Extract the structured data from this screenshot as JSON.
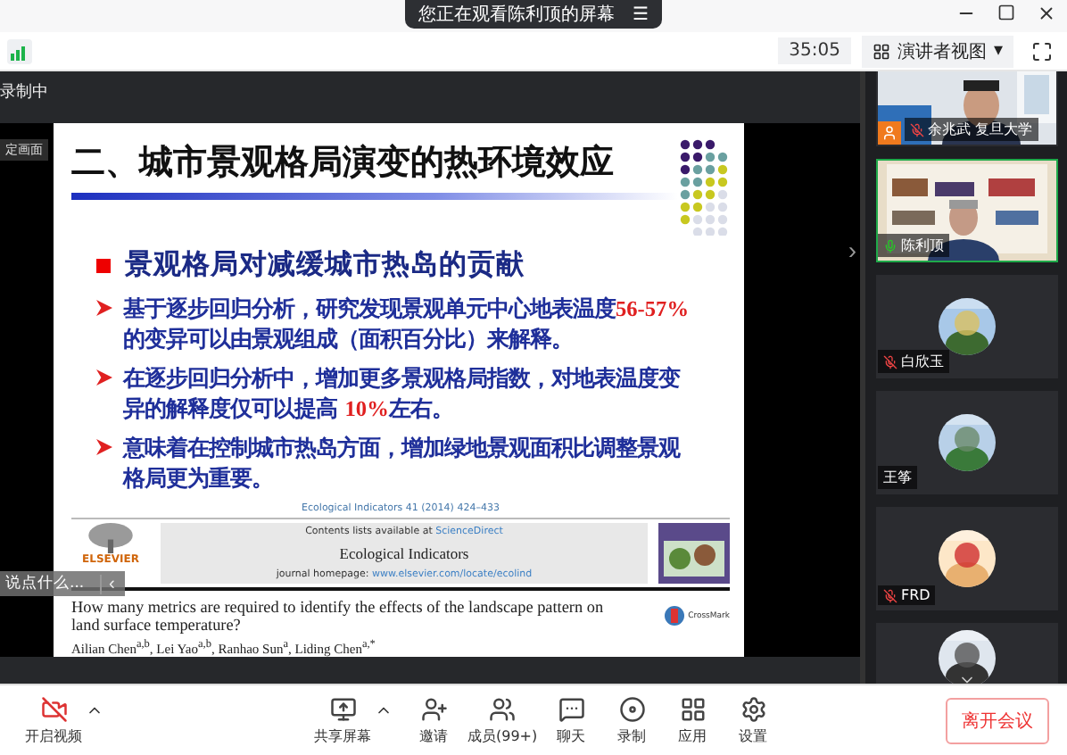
{
  "banner": {
    "text": "您正在观看陈利顶的屏幕",
    "menu_icon": "☰"
  },
  "timer": "35:05",
  "view_menu": {
    "label": "演讲者视图",
    "caret": "▾"
  },
  "recording": "录制中",
  "stage_label": "定画面",
  "slide": {
    "title": "二、城市景观格局演变的热环境效应",
    "heading": "景观格局对减缓城市热岛的贡献",
    "bullets": [
      [
        {
          "text": "基于逐步回归分析，研究发现景观单元中心地表温度",
          "highlight": false
        },
        {
          "text": "56-57%",
          "highlight": true
        },
        {
          "text": "的变异可以由景观组成（面积百分比）来解释。",
          "highlight": false
        }
      ],
      [
        {
          "text": "在逐步回归分析中，增加更多景观格局指数，对地表温度变异的解释度仅可以提高 ",
          "highlight": false
        },
        {
          "text": "10%",
          "highlight": true
        },
        {
          "text": "左右。",
          "highlight": false
        }
      ],
      [
        {
          "text": "意味着在控制城市热岛方面，增加绿地景观面积比调整景观格局更为重要。",
          "highlight": false
        }
      ]
    ],
    "paper": {
      "citation": "Ecological Indicators 41 (2014) 424–433",
      "publisher": "ELSEVIER",
      "contents": "Contents lists available at",
      "contents_link": "ScienceDirect",
      "journal": "Ecological Indicators",
      "homepage": "journal homepage:",
      "homepage_link": "www.elsevier.com/locate/ecolind",
      "title": "How many metrics are required to identify the effects of the landscape pattern on land surface temperature?",
      "crossmark": "CrossMark",
      "authors": "Ailian Chen$^{a,b}$, Lei Yao$^{a,b}$, Ranhao Sun$^{a}$, Liding Chen$^{a,*}$"
    }
  },
  "comment": {
    "placeholder": "说点什么...",
    "arrow": "‹"
  },
  "next_arrow": "›",
  "participants": [
    {
      "name": "余兆武 复旦大学",
      "kind": "video",
      "muted": true,
      "speaking": false,
      "host": true
    },
    {
      "name": "陈利顶",
      "kind": "video",
      "muted": false,
      "speaking": true,
      "host": false
    },
    {
      "name": "白欣玉",
      "kind": "avatar",
      "muted": true,
      "speaking": false,
      "host": false
    },
    {
      "name": "王筝",
      "kind": "avatar",
      "muted": false,
      "speaking": false,
      "host": false
    },
    {
      "name": "FRD",
      "kind": "avatar",
      "muted": true,
      "speaking": false,
      "host": false
    },
    {
      "kind": "avatar",
      "speaking": false
    }
  ],
  "toolbar": [
    {
      "label": "开启视频",
      "kind": "camera",
      "caret": true
    },
    {
      "label": "共享屏幕",
      "kind": "share",
      "caret": true
    },
    {
      "label": "邀请",
      "kind": "invite"
    },
    {
      "label": "成员(99+)",
      "kind": "members"
    },
    {
      "label": "聊天",
      "kind": "chat"
    },
    {
      "label": "录制",
      "kind": "record"
    },
    {
      "label": "应用",
      "kind": "apps"
    },
    {
      "label": "设置",
      "kind": "settings"
    }
  ],
  "leave_button": "离开会议"
}
